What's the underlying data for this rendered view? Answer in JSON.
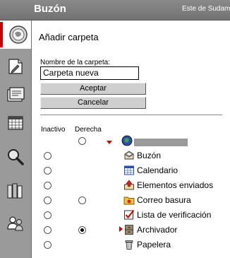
{
  "window": {
    "title": "Buzón",
    "region": "Este de Sudamé"
  },
  "sidebar": {
    "items": [
      {
        "name": "globe-icon"
      },
      {
        "name": "compose-icon"
      },
      {
        "name": "address-book-icon"
      },
      {
        "name": "calendar-icon"
      },
      {
        "name": "search-icon"
      },
      {
        "name": "library-icon"
      },
      {
        "name": "users-icon"
      }
    ]
  },
  "form": {
    "heading": "Añadir carpeta",
    "name_label": "Nombre de la carpeta:",
    "name_value": "Carpeta nueva",
    "accept_label": "Aceptar",
    "cancel_label": "Cancelar"
  },
  "columns": {
    "inactive": "Inactivo",
    "right": "Derecha"
  },
  "folders": [
    {
      "label": "Buzón",
      "icon": "mailbox-icon"
    },
    {
      "label": "Calendario",
      "icon": "calendar-icon"
    },
    {
      "label": "Elementos enviados",
      "icon": "sent-items-icon"
    },
    {
      "label": "Correo basura",
      "icon": "junk-mail-icon"
    },
    {
      "label": "Lista de verificación",
      "icon": "checklist-icon"
    },
    {
      "label": "Archivador",
      "icon": "cabinet-icon"
    },
    {
      "label": "Papelera",
      "icon": "trash-icon"
    }
  ],
  "colors": {
    "titlebar": "#7c7c7c",
    "sidebar": "#9a9a9a",
    "accent_red": "#cc0000"
  }
}
